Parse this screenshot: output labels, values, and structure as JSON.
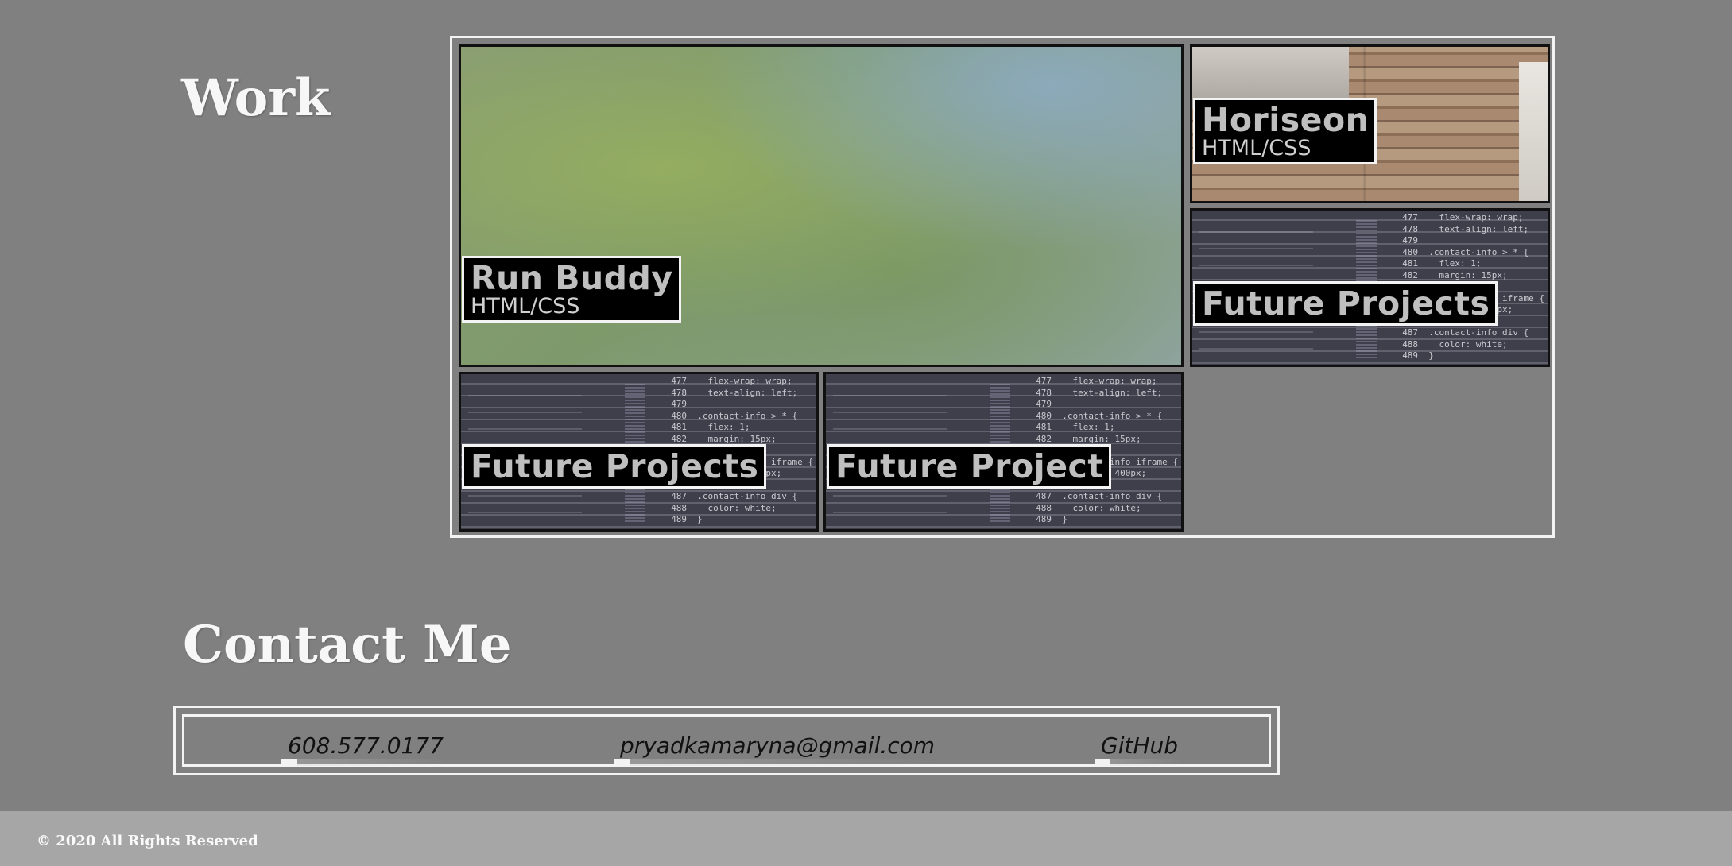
{
  "work": {
    "title": "Work",
    "projects": [
      {
        "title": "Run Buddy",
        "subtitle": "HTML/CSS",
        "image": "landscape-photo"
      },
      {
        "title": "Horiseon",
        "subtitle": "HTML/CSS",
        "image": "office-photo"
      },
      {
        "title": "Future Projects",
        "subtitle": "",
        "image": "code-screenshot"
      },
      {
        "title": "Future Projects",
        "subtitle": "",
        "image": "code-screenshot"
      },
      {
        "title": "Future Project",
        "subtitle": "",
        "image": "code-screenshot"
      }
    ]
  },
  "contact": {
    "title": "Contact Me",
    "links": [
      {
        "label": "608.577.0177"
      },
      {
        "label": "pryadkamaryna@gmail.com"
      },
      {
        "label": "GitHub"
      }
    ]
  },
  "footer": {
    "text": "© 2020 All Rights Reserved"
  },
  "colors": {
    "background": "#808080",
    "footer_background": "#a6a6a6",
    "label_background": "#000000",
    "border": "#f3f3f3"
  }
}
